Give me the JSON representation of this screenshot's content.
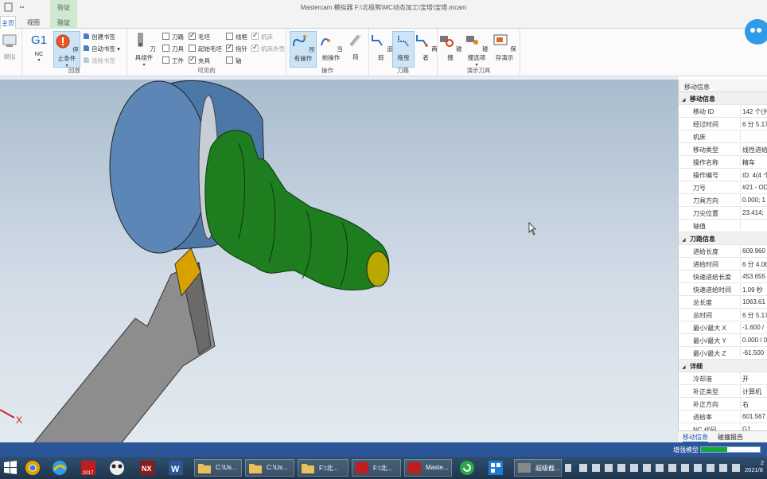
{
  "window": {
    "title": "Mastercam 模拟器  F:\\北极熊\\MC动态加工\\宝塔\\宝塔.mcam",
    "context_tab_header": "验证"
  },
  "tabs": [
    {
      "label": "主页",
      "active": true
    },
    {
      "label": "视图",
      "active": false
    },
    {
      "label": "验证",
      "active": false
    }
  ],
  "ribbon": {
    "simulate_label": "模拟",
    "nc_label": "NC",
    "g1_label": "G1",
    "stop_condition_label": "停止条件",
    "create_bookmark": "创建书签",
    "auto_bookmark": "自动书签",
    "clear_bookmark": "清除书签",
    "playback_group": "回放",
    "tool_component_label": "刀具组件",
    "visible_group": "可见的",
    "checks": [
      {
        "label": "刀路",
        "checked": false
      },
      {
        "label": "毛坯",
        "checked": true
      },
      {
        "label": "线框",
        "checked": false
      },
      {
        "label": "机床",
        "checked": true,
        "disabled": true
      },
      {
        "label": "刀具",
        "checked": false
      },
      {
        "label": "起始毛坯",
        "checked": false
      },
      {
        "label": "指针",
        "checked": true
      },
      {
        "label": "机床外壳",
        "checked": true,
        "disabled": true
      },
      {
        "label": "工件",
        "checked": false
      },
      {
        "label": "夹具",
        "checked": true
      },
      {
        "label": "轴",
        "checked": false
      }
    ],
    "operation_group": "操作",
    "all_operations": "所有操作",
    "current_operation": "当前操作",
    "segment": "段",
    "toolpath_group": "刀路",
    "trace": "追踪",
    "trail": "拖曳",
    "both": "两者",
    "demo_group": "演示刀具",
    "collision": "碰撞",
    "collision_options": "碰撞选项",
    "save_demo": "保存演示"
  },
  "panel": {
    "header": "移动信息",
    "sections": [
      {
        "title": "移动信息",
        "rows": [
          {
            "k": "移动 ID",
            "v": "142 个(共"
          },
          {
            "k": "经过时间",
            "v": "6 分 5.17"
          },
          {
            "k": "机床",
            "v": ""
          },
          {
            "k": "移动类型",
            "v": "线性进给"
          },
          {
            "k": "操作名称",
            "v": "精车"
          },
          {
            "k": "操作编号",
            "v": "ID: 4(4 个"
          },
          {
            "k": "刀号",
            "v": "#21 - OD"
          },
          {
            "k": "刀具方向",
            "v": "0.000; 1"
          },
          {
            "k": "刀尖位置",
            "v": "23.414;"
          },
          {
            "k": "轴值",
            "v": ""
          }
        ]
      },
      {
        "title": "刀路信息",
        "rows": [
          {
            "k": "进给长度",
            "v": "609.960"
          },
          {
            "k": "进给时间",
            "v": "6 分 4.08"
          },
          {
            "k": "快速进给长度",
            "v": "453.655"
          },
          {
            "k": "快速进给时间",
            "v": "1.09 秒"
          },
          {
            "k": "总长度",
            "v": "1063.61"
          },
          {
            "k": "总时间",
            "v": "6 分 5.17"
          },
          {
            "k": "最小/最大 X",
            "v": "-1.600 /"
          },
          {
            "k": "最小/最大 Y",
            "v": "0.000 / 0"
          },
          {
            "k": "最小/最大 Z",
            "v": "-61.500"
          }
        ]
      },
      {
        "title": "详细",
        "rows": [
          {
            "k": "冷却液",
            "v": "开"
          },
          {
            "k": "补正类型",
            "v": "计算机"
          },
          {
            "k": "补正方向",
            "v": "右"
          },
          {
            "k": "进给率",
            "v": "601.567"
          },
          {
            "k": "NC 代码",
            "v": "G1"
          }
        ]
      }
    ],
    "tabs": [
      "移动信息",
      "碰撞报告"
    ]
  },
  "viewport": {
    "axis_label": "X"
  },
  "status": {
    "enhanced_label": "增强模型",
    "progress": 0.45
  },
  "taskbar": {
    "windows": [
      {
        "label": "C:\\Us..."
      },
      {
        "label": "C:\\Us..."
      },
      {
        "label": "F:\\北..."
      },
      {
        "label": "F:\\北..."
      },
      {
        "label": "Maste..."
      },
      {
        "label": "超级截..."
      }
    ],
    "clock_time": "2",
    "clock_date": "2021/8"
  },
  "colors": {
    "accent": "#1b5fb6",
    "status_bar": "#2b579a",
    "chuck": "#5b86b5",
    "part": "#1e7d1e",
    "insert": "#d9a100"
  }
}
